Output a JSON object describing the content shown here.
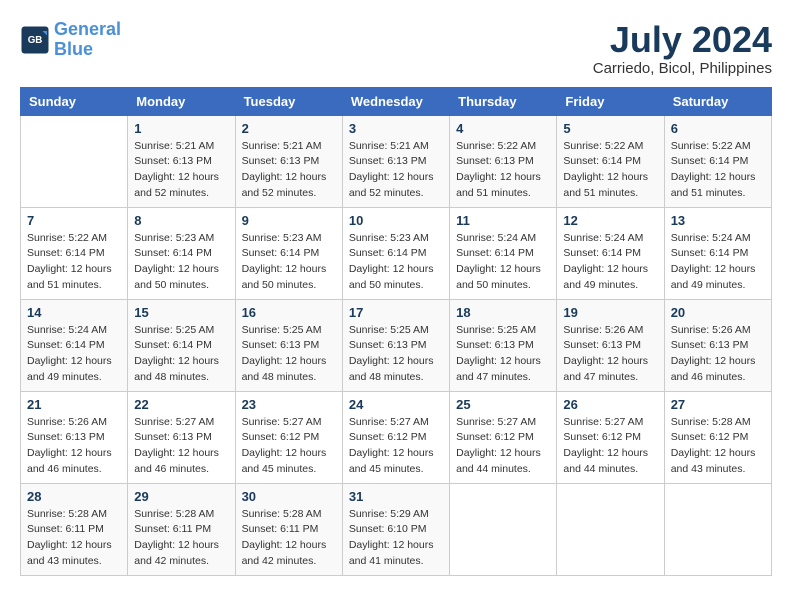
{
  "header": {
    "logo_line1": "General",
    "logo_line2": "Blue",
    "month_year": "July 2024",
    "location": "Carriedo, Bicol, Philippines"
  },
  "days_of_week": [
    "Sunday",
    "Monday",
    "Tuesday",
    "Wednesday",
    "Thursday",
    "Friday",
    "Saturday"
  ],
  "weeks": [
    [
      {
        "day": null,
        "info": null
      },
      {
        "day": "1",
        "info": "Sunrise: 5:21 AM\nSunset: 6:13 PM\nDaylight: 12 hours\nand 52 minutes."
      },
      {
        "day": "2",
        "info": "Sunrise: 5:21 AM\nSunset: 6:13 PM\nDaylight: 12 hours\nand 52 minutes."
      },
      {
        "day": "3",
        "info": "Sunrise: 5:21 AM\nSunset: 6:13 PM\nDaylight: 12 hours\nand 52 minutes."
      },
      {
        "day": "4",
        "info": "Sunrise: 5:22 AM\nSunset: 6:13 PM\nDaylight: 12 hours\nand 51 minutes."
      },
      {
        "day": "5",
        "info": "Sunrise: 5:22 AM\nSunset: 6:14 PM\nDaylight: 12 hours\nand 51 minutes."
      },
      {
        "day": "6",
        "info": "Sunrise: 5:22 AM\nSunset: 6:14 PM\nDaylight: 12 hours\nand 51 minutes."
      }
    ],
    [
      {
        "day": "7",
        "info": "Sunrise: 5:22 AM\nSunset: 6:14 PM\nDaylight: 12 hours\nand 51 minutes."
      },
      {
        "day": "8",
        "info": "Sunrise: 5:23 AM\nSunset: 6:14 PM\nDaylight: 12 hours\nand 50 minutes."
      },
      {
        "day": "9",
        "info": "Sunrise: 5:23 AM\nSunset: 6:14 PM\nDaylight: 12 hours\nand 50 minutes."
      },
      {
        "day": "10",
        "info": "Sunrise: 5:23 AM\nSunset: 6:14 PM\nDaylight: 12 hours\nand 50 minutes."
      },
      {
        "day": "11",
        "info": "Sunrise: 5:24 AM\nSunset: 6:14 PM\nDaylight: 12 hours\nand 50 minutes."
      },
      {
        "day": "12",
        "info": "Sunrise: 5:24 AM\nSunset: 6:14 PM\nDaylight: 12 hours\nand 49 minutes."
      },
      {
        "day": "13",
        "info": "Sunrise: 5:24 AM\nSunset: 6:14 PM\nDaylight: 12 hours\nand 49 minutes."
      }
    ],
    [
      {
        "day": "14",
        "info": "Sunrise: 5:24 AM\nSunset: 6:14 PM\nDaylight: 12 hours\nand 49 minutes."
      },
      {
        "day": "15",
        "info": "Sunrise: 5:25 AM\nSunset: 6:14 PM\nDaylight: 12 hours\nand 48 minutes."
      },
      {
        "day": "16",
        "info": "Sunrise: 5:25 AM\nSunset: 6:13 PM\nDaylight: 12 hours\nand 48 minutes."
      },
      {
        "day": "17",
        "info": "Sunrise: 5:25 AM\nSunset: 6:13 PM\nDaylight: 12 hours\nand 48 minutes."
      },
      {
        "day": "18",
        "info": "Sunrise: 5:25 AM\nSunset: 6:13 PM\nDaylight: 12 hours\nand 47 minutes."
      },
      {
        "day": "19",
        "info": "Sunrise: 5:26 AM\nSunset: 6:13 PM\nDaylight: 12 hours\nand 47 minutes."
      },
      {
        "day": "20",
        "info": "Sunrise: 5:26 AM\nSunset: 6:13 PM\nDaylight: 12 hours\nand 46 minutes."
      }
    ],
    [
      {
        "day": "21",
        "info": "Sunrise: 5:26 AM\nSunset: 6:13 PM\nDaylight: 12 hours\nand 46 minutes."
      },
      {
        "day": "22",
        "info": "Sunrise: 5:27 AM\nSunset: 6:13 PM\nDaylight: 12 hours\nand 46 minutes."
      },
      {
        "day": "23",
        "info": "Sunrise: 5:27 AM\nSunset: 6:12 PM\nDaylight: 12 hours\nand 45 minutes."
      },
      {
        "day": "24",
        "info": "Sunrise: 5:27 AM\nSunset: 6:12 PM\nDaylight: 12 hours\nand 45 minutes."
      },
      {
        "day": "25",
        "info": "Sunrise: 5:27 AM\nSunset: 6:12 PM\nDaylight: 12 hours\nand 44 minutes."
      },
      {
        "day": "26",
        "info": "Sunrise: 5:27 AM\nSunset: 6:12 PM\nDaylight: 12 hours\nand 44 minutes."
      },
      {
        "day": "27",
        "info": "Sunrise: 5:28 AM\nSunset: 6:12 PM\nDaylight: 12 hours\nand 43 minutes."
      }
    ],
    [
      {
        "day": "28",
        "info": "Sunrise: 5:28 AM\nSunset: 6:11 PM\nDaylight: 12 hours\nand 43 minutes."
      },
      {
        "day": "29",
        "info": "Sunrise: 5:28 AM\nSunset: 6:11 PM\nDaylight: 12 hours\nand 42 minutes."
      },
      {
        "day": "30",
        "info": "Sunrise: 5:28 AM\nSunset: 6:11 PM\nDaylight: 12 hours\nand 42 minutes."
      },
      {
        "day": "31",
        "info": "Sunrise: 5:29 AM\nSunset: 6:10 PM\nDaylight: 12 hours\nand 41 minutes."
      },
      {
        "day": null,
        "info": null
      },
      {
        "day": null,
        "info": null
      },
      {
        "day": null,
        "info": null
      }
    ]
  ]
}
